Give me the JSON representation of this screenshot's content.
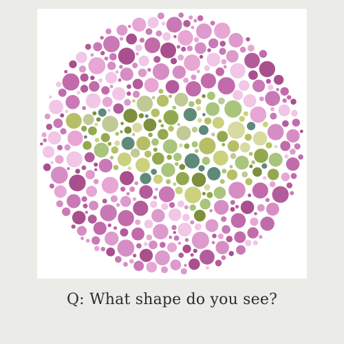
{
  "question": "Q: What shape do you see?",
  "plate": {
    "icon": "color-vision-test-plate-fish-icon",
    "colors": {
      "background": "#ebebe7",
      "card": "#ffffff",
      "dots_background": [
        "#c979b6",
        "#d68dc4",
        "#b35c9c",
        "#e7a6d4",
        "#f1c6e6",
        "#a94f8e",
        "#dc9acd",
        "#c26bab"
      ],
      "dots_figure": [
        "#b7bf66",
        "#93a94f",
        "#cbd17d",
        "#7e8f3d",
        "#a9c47c",
        "#5f8a7a",
        "#d7dba0",
        "#c1c996"
      ]
    }
  }
}
